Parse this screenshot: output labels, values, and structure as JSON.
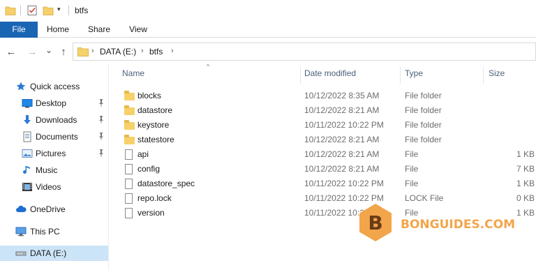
{
  "window": {
    "title": "btfs",
    "quick_access_icons": [
      "folder-icon",
      "properties-icon",
      "new-folder-icon"
    ],
    "quick_access_dropdown": "▾"
  },
  "ribbon": {
    "tabs": [
      {
        "label": "File",
        "active": true
      },
      {
        "label": "Home"
      },
      {
        "label": "Share"
      },
      {
        "label": "View"
      }
    ]
  },
  "navigation": {
    "back": "←",
    "forward": "→",
    "recent": "⌄",
    "up": "↑",
    "breadcrumb": [
      "DATA (E:)",
      "btfs"
    ],
    "separator": "›"
  },
  "sidebar": {
    "items": [
      {
        "label": "Quick access",
        "icon": "star-icon"
      },
      {
        "label": "Desktop",
        "icon": "desktop-icon",
        "pinned": true
      },
      {
        "label": "Downloads",
        "icon": "download-icon",
        "pinned": true
      },
      {
        "label": "Documents",
        "icon": "documents-icon",
        "pinned": true
      },
      {
        "label": "Pictures",
        "icon": "pictures-icon",
        "pinned": true
      },
      {
        "label": "Music",
        "icon": "music-icon"
      },
      {
        "label": "Videos",
        "icon": "videos-icon"
      },
      {
        "label": "OneDrive",
        "icon": "cloud-icon"
      },
      {
        "label": "This PC",
        "icon": "computer-icon"
      },
      {
        "label": "DATA (E:)",
        "icon": "drive-icon",
        "selected": true
      }
    ],
    "pin_glyph": "📌"
  },
  "filelist": {
    "columns": {
      "name": "Name",
      "date": "Date modified",
      "type": "Type",
      "size": "Size"
    },
    "sort_glyph": "^",
    "rows": [
      {
        "name": "blocks",
        "date": "10/12/2022 8:35 AM",
        "type": "File folder",
        "size": "",
        "kind": "folder"
      },
      {
        "name": "datastore",
        "date": "10/12/2022 8:21 AM",
        "type": "File folder",
        "size": "",
        "kind": "folder"
      },
      {
        "name": "keystore",
        "date": "10/11/2022 10:22 PM",
        "type": "File folder",
        "size": "",
        "kind": "folder"
      },
      {
        "name": "statestore",
        "date": "10/12/2022 8:21 AM",
        "type": "File folder",
        "size": "",
        "kind": "folder"
      },
      {
        "name": "api",
        "date": "10/12/2022 8:21 AM",
        "type": "File",
        "size": "1 KB",
        "kind": "file"
      },
      {
        "name": "config",
        "date": "10/12/2022 8:21 AM",
        "type": "File",
        "size": "7 KB",
        "kind": "file"
      },
      {
        "name": "datastore_spec",
        "date": "10/11/2022 10:22 PM",
        "type": "File",
        "size": "1 KB",
        "kind": "file"
      },
      {
        "name": "repo.lock",
        "date": "10/11/2022 10:22 PM",
        "type": "LOCK File",
        "size": "0 KB",
        "kind": "file"
      },
      {
        "name": "version",
        "date": "10/11/2022 10:22 PM",
        "type": "File",
        "size": "1 KB",
        "kind": "file"
      }
    ]
  },
  "watermark": {
    "letter": "B",
    "text": "BONGUIDES.COM",
    "color": "#f2a54a"
  },
  "colors": {
    "accent": "#1a64b4",
    "selected": "#cce4f7",
    "folder": "#f6d06a",
    "header_text": "#4c607a"
  }
}
